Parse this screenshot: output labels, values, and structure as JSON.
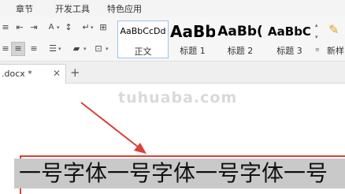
{
  "menu": {
    "items": [
      "章节",
      "开发工具",
      "特色应用"
    ]
  },
  "ribbon": {
    "styles": [
      {
        "preview": "AaBbCcDd",
        "name": "正文"
      },
      {
        "preview": "AaBb",
        "name": "标题 1"
      },
      {
        "preview": "AaBb(",
        "name": "标题 2"
      },
      {
        "preview": "AaBbC",
        "name": "标题 3"
      }
    ],
    "new_style_label": "新样"
  },
  "tabs": {
    "doc_tab_label": ".docx *",
    "add_tab_label": "+"
  },
  "document": {
    "watermark": "tuhuaba.com",
    "text": "一号字体一号字体一号字体一号"
  },
  "colors": {
    "arrow": "#d9413b",
    "selection_box": "#d9413b",
    "text_highlight": "#c9c9c9"
  }
}
